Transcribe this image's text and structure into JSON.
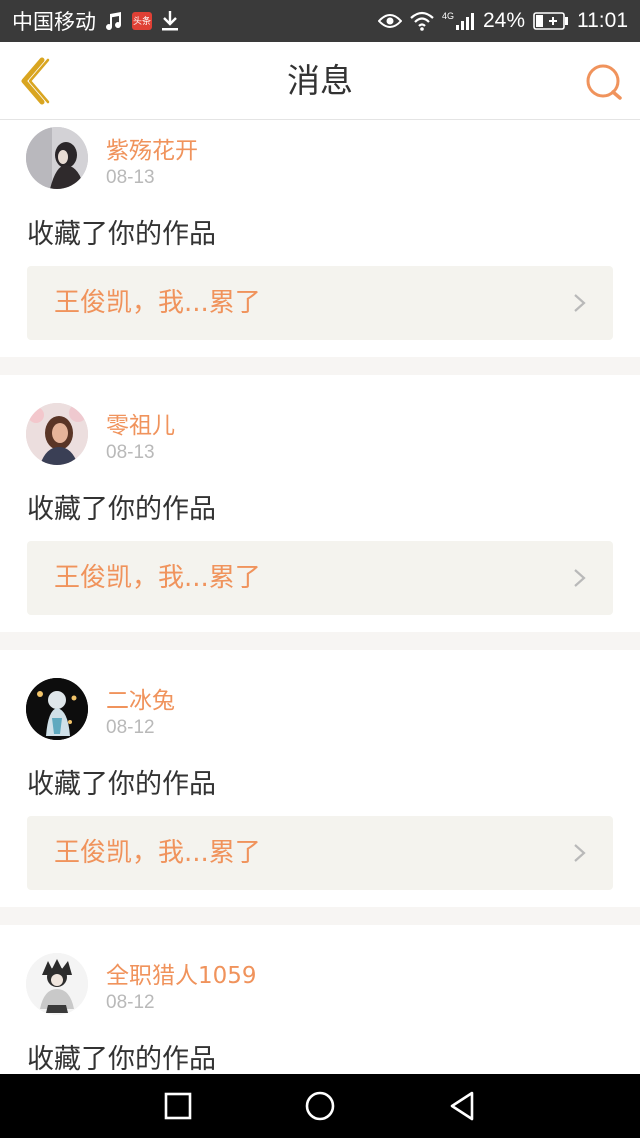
{
  "status_bar": {
    "carrier": "中国移动",
    "news_badge": "头条",
    "network": "4G",
    "battery": "24%",
    "time": "11:01"
  },
  "header": {
    "title": "消息"
  },
  "icons": {
    "back": "chevron-left-icon",
    "search": "search-icon",
    "chevron": "chevron-right-icon",
    "nav_recent": "square-icon",
    "nav_home": "circle-icon",
    "nav_back": "triangle-back-icon"
  },
  "colors": {
    "accent": "#f0935c",
    "back_icon": "#d9a520",
    "text": "#333333",
    "muted": "#b9b9b9",
    "work_box_bg": "#f4f3ee"
  },
  "notifications": [
    {
      "username": "紫殇花开",
      "date": "08-13",
      "action": "收藏了你的作品",
      "work_title": "王俊凯，我...累了"
    },
    {
      "username": "零祖儿",
      "date": "08-13",
      "action": "收藏了你的作品",
      "work_title": "王俊凯，我...累了"
    },
    {
      "username": "二冰兔",
      "date": "08-12",
      "action": "收藏了你的作品",
      "work_title": "王俊凯，我...累了"
    },
    {
      "username": "全职猎人1059",
      "date": "08-12",
      "action": "收藏了你的作品"
    }
  ]
}
